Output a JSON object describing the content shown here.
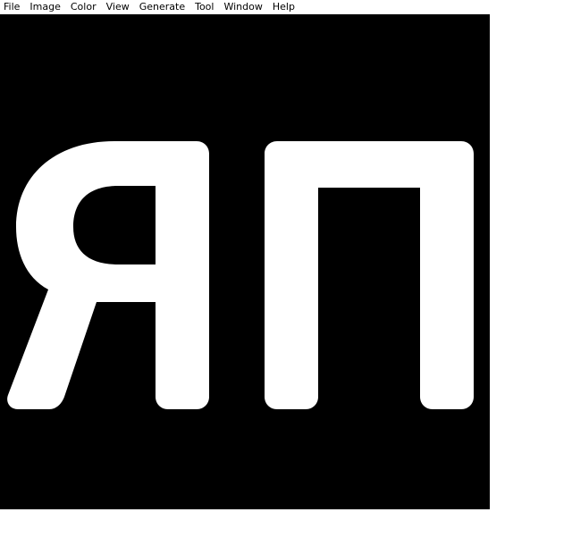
{
  "menubar": {
    "items": [
      {
        "label": "File"
      },
      {
        "label": "Image"
      },
      {
        "label": "Color"
      },
      {
        "label": "View"
      },
      {
        "label": "Generate"
      },
      {
        "label": "Tool"
      },
      {
        "label": "Window"
      },
      {
        "label": "Help"
      }
    ]
  },
  "canvas": {
    "background_color": "#000000",
    "glyph_color": "#ffffff",
    "glyphs": [
      "Я",
      "П"
    ]
  },
  "workspace": {
    "background_color": "#ffffff"
  }
}
